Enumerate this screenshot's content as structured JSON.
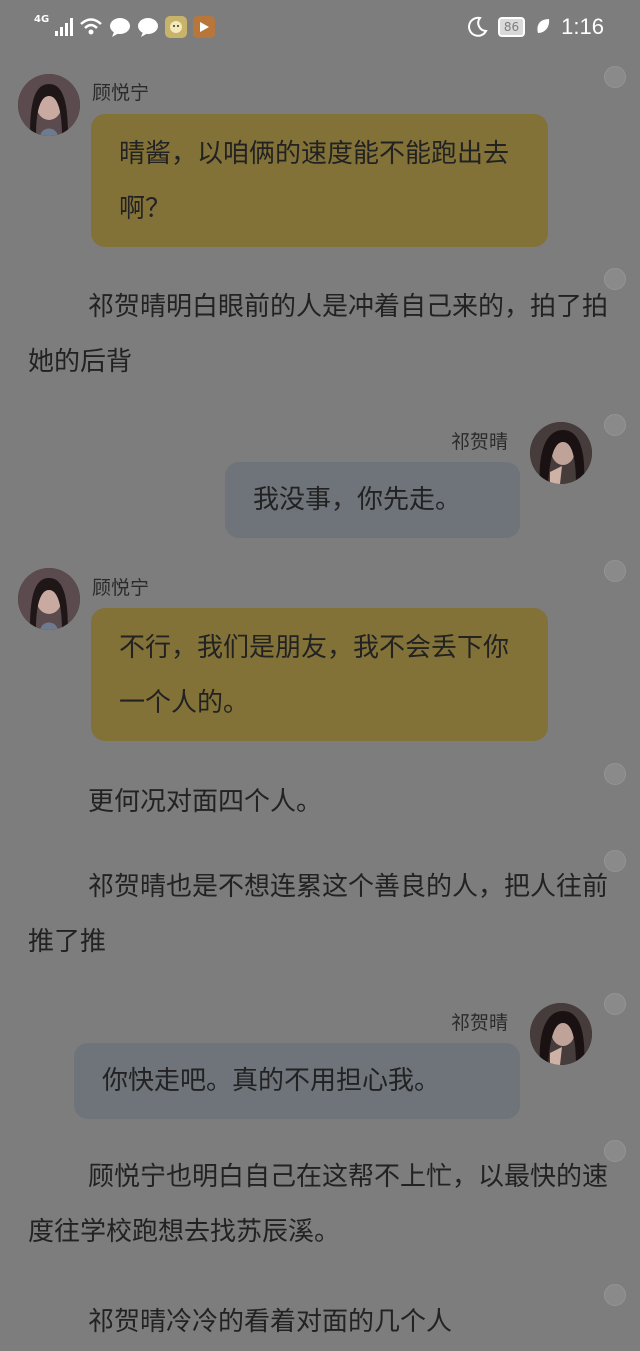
{
  "status_bar": {
    "network": "4G",
    "battery": "86",
    "time": "1:16"
  },
  "messages": [
    {
      "sender": "顾悦宁",
      "side": "left",
      "text": "晴酱，以咱俩的速度能不能跑出去啊？",
      "color": "#837238"
    },
    {
      "narration": "祁贺晴明白眼前的人是冲着自己来的，拍了拍她的后背"
    },
    {
      "sender": "祁贺晴",
      "side": "right",
      "text": "我没事，你先走。",
      "color": "#6e747a"
    },
    {
      "sender": "顾悦宁",
      "side": "left",
      "text": "不行，我们是朋友，我不会丢下你一个人的。",
      "color": "#837238"
    },
    {
      "narration": "更何况对面四个人。"
    },
    {
      "narration": "祁贺晴也是不想连累这个善良的人，把人往前推了推"
    },
    {
      "sender": "祁贺晴",
      "side": "right",
      "text": "你快走吧。真的不用担心我。",
      "color": "#6e747a"
    },
    {
      "narration": "顾悦宁也明白自己在这帮不上忙，以最快的速度往学校跑想去找苏辰溪。"
    },
    {
      "narration": "祁贺晴冷冷的看着对面的几个人"
    }
  ]
}
